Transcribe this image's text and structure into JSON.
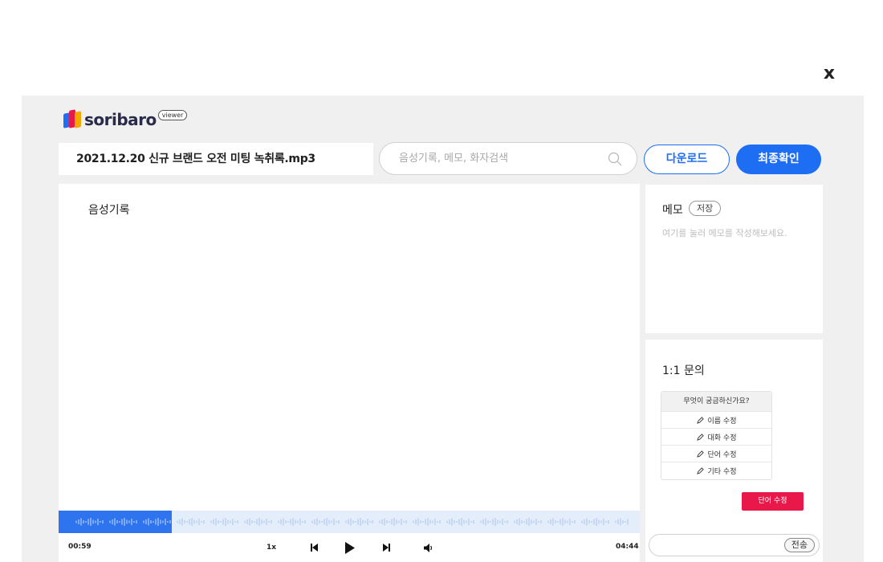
{
  "close_label": "x",
  "logo": {
    "word": "soribaro",
    "badge": "viewer",
    "colors": [
      "#1e6ef4",
      "#e8184b",
      "#f7a600"
    ]
  },
  "header": {
    "filename": "2021.12.20 신규 브랜드 오전 미팅 녹취록.mp3",
    "search_placeholder": "음성기록, 메모, 화자검색",
    "download_label": "다운로드",
    "confirm_label": "최종확인"
  },
  "transcript": {
    "title": "음성기록"
  },
  "player": {
    "current_time": "00:59",
    "total_time": "04:44",
    "speed": "1x",
    "progress": 0.195
  },
  "memo": {
    "title": "메모",
    "save_label": "저장",
    "placeholder": "여기를 눌러 메모를 작성해보세요."
  },
  "inquiry": {
    "title": "1:1 문의",
    "faq_header": "무엇이 궁금하신가요?",
    "faq_items": [
      "이름 수정",
      "대화 수정",
      "단어 수정",
      "기타 수정"
    ],
    "word_button": "단어 수정",
    "send_label": "전송"
  },
  "colors": {
    "accent": "#1e6ef4",
    "danger": "#e8184b",
    "panel_bg": "#f0f0f0"
  }
}
